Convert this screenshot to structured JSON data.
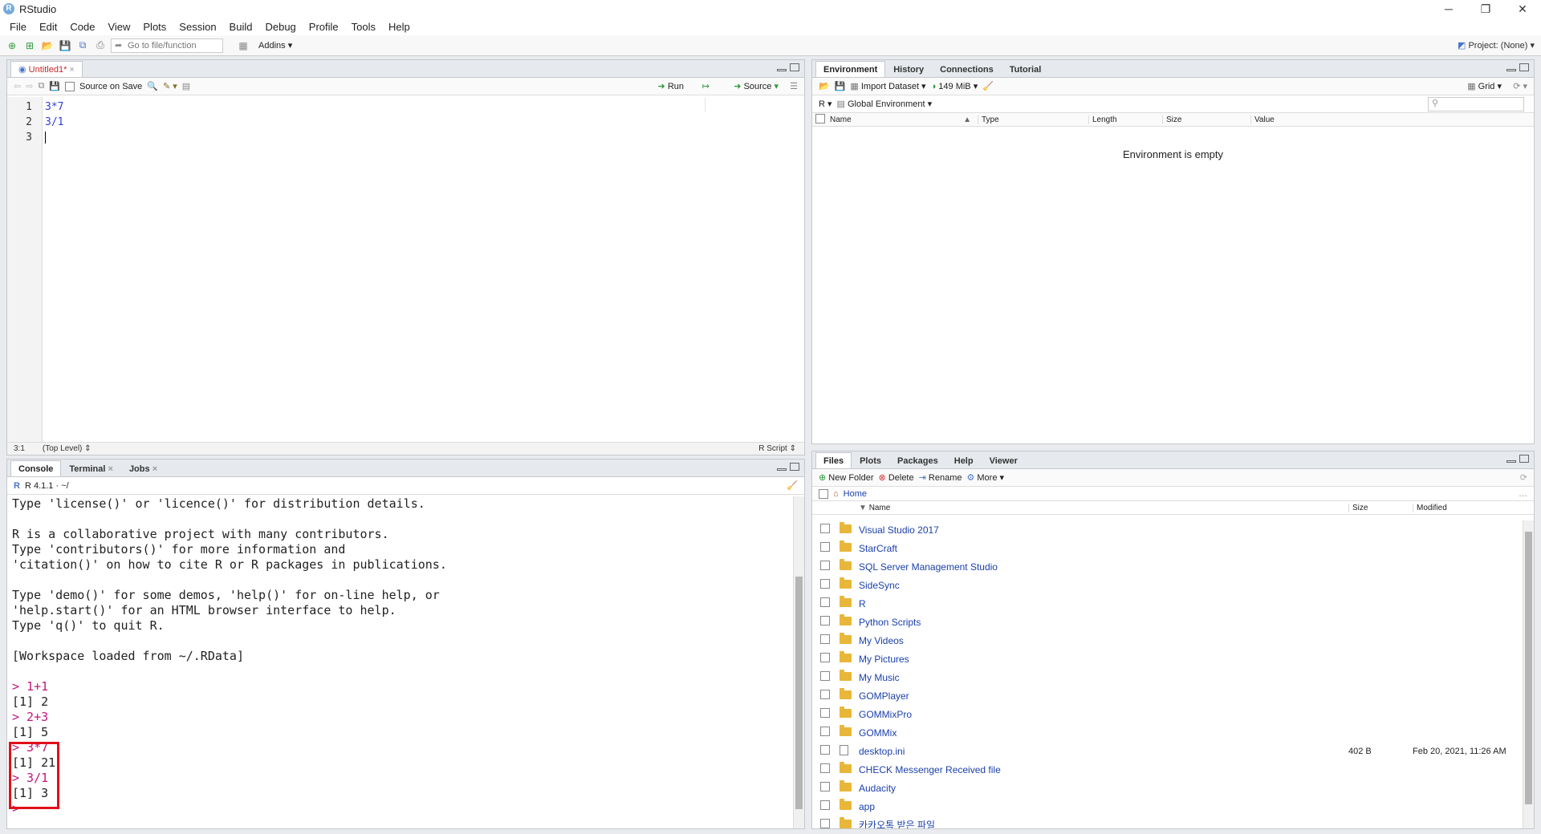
{
  "window": {
    "title": "RStudio",
    "controls": [
      "─",
      "❐",
      "✕"
    ]
  },
  "menu": [
    "File",
    "Edit",
    "Code",
    "View",
    "Plots",
    "Session",
    "Build",
    "Debug",
    "Profile",
    "Tools",
    "Help"
  ],
  "toolbar": {
    "goto_placeholder": "Go to file/function",
    "addins": "Addins",
    "project": "Project: (None)"
  },
  "editor": {
    "tab": "Untitled1*",
    "source_on_save": "Source on Save",
    "run": "Run",
    "source": "Source",
    "lines": [
      "1",
      "2",
      "3"
    ],
    "code": [
      "3*7",
      "3/1",
      ""
    ],
    "status": {
      "pos": "3:1",
      "scope": "(Top Level)",
      "type": "R Script"
    }
  },
  "console": {
    "tabs": [
      "Console",
      "Terminal",
      "Jobs"
    ],
    "version": "R 4.1.1 · ~/",
    "lines": [
      {
        "t": "Type 'license()' or 'licence()' for distribution details.",
        "c": ""
      },
      {
        "t": "",
        "c": ""
      },
      {
        "t": "R is a collaborative project with many contributors.",
        "c": ""
      },
      {
        "t": "Type 'contributors()' for more information and",
        "c": ""
      },
      {
        "t": "'citation()' on how to cite R or R packages in publications.",
        "c": ""
      },
      {
        "t": "",
        "c": ""
      },
      {
        "t": "Type 'demo()' for some demos, 'help()' for on-line help, or",
        "c": ""
      },
      {
        "t": "'help.start()' for an HTML browser interface to help.",
        "c": ""
      },
      {
        "t": "Type 'q()' to quit R.",
        "c": ""
      },
      {
        "t": "",
        "c": ""
      },
      {
        "t": "[Workspace loaded from ~/.RData]",
        "c": ""
      },
      {
        "t": "",
        "c": ""
      },
      {
        "t": "> 1+1",
        "c": "prompt"
      },
      {
        "t": "[1] 2",
        "c": ""
      },
      {
        "t": "> 2+3",
        "c": "prompt"
      },
      {
        "t": "[1] 5",
        "c": ""
      },
      {
        "t": "> 3*7",
        "c": "prompt"
      },
      {
        "t": "[1] 21",
        "c": ""
      },
      {
        "t": "> 3/1",
        "c": "prompt"
      },
      {
        "t": "[1] 3",
        "c": ""
      },
      {
        "t": "> ",
        "c": "prompt"
      }
    ]
  },
  "environment": {
    "tabs": [
      "Environment",
      "History",
      "Connections",
      "Tutorial"
    ],
    "import": "Import Dataset",
    "mem": "149 MiB",
    "grid": "Grid",
    "lang": "R",
    "scope": "Global Environment",
    "columns": [
      "Name",
      "Type",
      "Length",
      "Size",
      "Value"
    ],
    "empty": "Environment is empty"
  },
  "files": {
    "tabs": [
      "Files",
      "Plots",
      "Packages",
      "Help",
      "Viewer"
    ],
    "new_folder": "New Folder",
    "delete": "Delete",
    "rename": "Rename",
    "more": "More",
    "path": "Home",
    "columns": [
      "Name",
      "Size",
      "Modified"
    ],
    "rows": [
      {
        "name": "Visual Studio 2017",
        "size": "",
        "modified": "",
        "file": false
      },
      {
        "name": "StarCraft",
        "size": "",
        "modified": "",
        "file": false
      },
      {
        "name": "SQL Server Management Studio",
        "size": "",
        "modified": "",
        "file": false
      },
      {
        "name": "SideSync",
        "size": "",
        "modified": "",
        "file": false
      },
      {
        "name": "R",
        "size": "",
        "modified": "",
        "file": false
      },
      {
        "name": "Python Scripts",
        "size": "",
        "modified": "",
        "file": false
      },
      {
        "name": "My Videos",
        "size": "",
        "modified": "",
        "file": false
      },
      {
        "name": "My Pictures",
        "size": "",
        "modified": "",
        "file": false
      },
      {
        "name": "My Music",
        "size": "",
        "modified": "",
        "file": false
      },
      {
        "name": "GOMPlayer",
        "size": "",
        "modified": "",
        "file": false
      },
      {
        "name": "GOMMixPro",
        "size": "",
        "modified": "",
        "file": false
      },
      {
        "name": "GOMMix",
        "size": "",
        "modified": "",
        "file": false
      },
      {
        "name": "desktop.ini",
        "size": "402 B",
        "modified": "Feb 20, 2021, 11:26 AM",
        "file": true
      },
      {
        "name": "CHECK Messenger Received file",
        "size": "",
        "modified": "",
        "file": false
      },
      {
        "name": "Audacity",
        "size": "",
        "modified": "",
        "file": false
      },
      {
        "name": "app",
        "size": "",
        "modified": "",
        "file": false
      },
      {
        "name": "카카오톡 받은 파일",
        "size": "",
        "modified": "",
        "file": false
      }
    ]
  }
}
